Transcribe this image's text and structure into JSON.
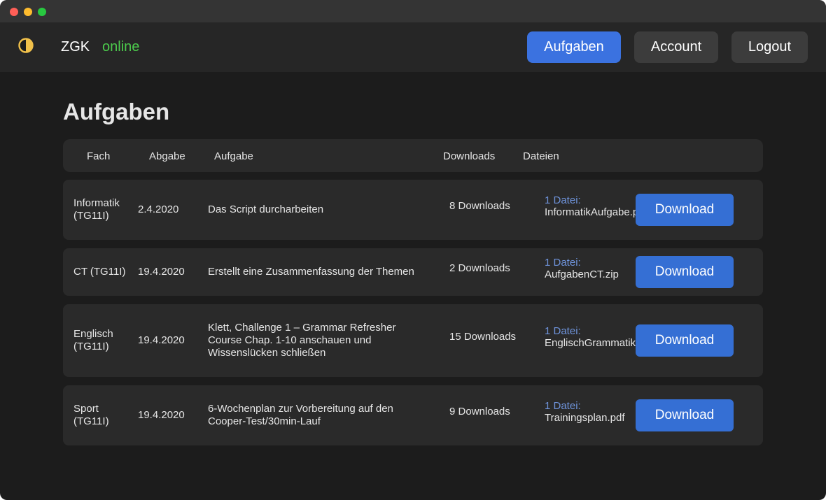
{
  "nav": {
    "brand": "ZGK",
    "status": "online",
    "status_color": "#4ccc4c",
    "logo_icon": "half-circle-contrast-icon",
    "buttons": [
      "Aufgaben",
      "Account",
      "Logout"
    ],
    "active": "Aufgaben"
  },
  "page": {
    "title": "Aufgaben"
  },
  "table": {
    "headers": [
      "Fach",
      "Abgabe",
      "Aufgabe",
      "Downloads",
      "Dateien"
    ],
    "rows": [
      {
        "fach": [
          "Informatik",
          "(TG11I)"
        ],
        "abgabe": "2.4.2020",
        "aufgabe": [
          "Das Script durcharbeiten"
        ],
        "downloads": "8 Downloads",
        "files_count": "1 Datei:",
        "file_name": "InformatikAufgabe.pdf",
        "button": "Download"
      },
      {
        "fach": [
          "CT (TG11I)"
        ],
        "abgabe": "19.4.2020",
        "aufgabe": [
          "Erstellt eine Zusammenfassung der Themen"
        ],
        "downloads": "2 Downloads",
        "files_count": "1 Datei:",
        "file_name": "AufgabenCT.zip",
        "button": "Download"
      },
      {
        "fach": [
          "Englisch",
          "(TG11I)"
        ],
        "abgabe": "19.4.2020",
        "aufgabe": [
          "Klett, Challenge 1 – Grammar Refresher",
          "Course Chap. 1-10 anschauen und",
          "Wissenslücken schließen"
        ],
        "downloads": "15 Downloads",
        "files_count": "1 Datei:",
        "file_name": "EnglischGrammatik.pdf",
        "button": "Download"
      },
      {
        "fach": [
          "Sport",
          "(TG11I)"
        ],
        "abgabe": "19.4.2020",
        "aufgabe": [
          "6-Wochenplan zur Vorbereitung auf den",
          "Cooper-Test/30min-Lauf"
        ],
        "downloads": "9 Downloads",
        "files_count": "1 Datei:",
        "file_name": "Trainingsplan.pdf",
        "button": "Download"
      }
    ]
  },
  "colors": {
    "accent": "#3b72e0",
    "download_button": "#356fd4",
    "file_count": "#6f94dc",
    "background": "#1c1c1c",
    "card": "#2a2a2a"
  }
}
